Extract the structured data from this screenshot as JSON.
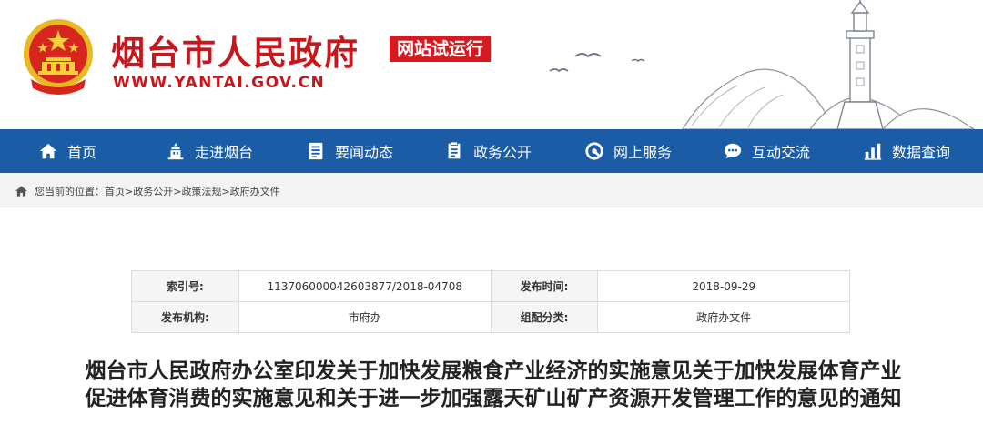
{
  "header": {
    "site_title": "烟台市人民政府",
    "badge": "网站试运行",
    "url": "WWW.YANTAI.GOV.CN",
    "colors": {
      "brand_red": "#c8161d",
      "nav_blue": "#1a5ca6"
    }
  },
  "nav": {
    "items": [
      {
        "label": "首页",
        "icon": "home-icon"
      },
      {
        "label": "走进烟台",
        "icon": "building-icon"
      },
      {
        "label": "要闻动态",
        "icon": "document-icon"
      },
      {
        "label": "政务公开",
        "icon": "file-list-icon"
      },
      {
        "label": "网上服务",
        "icon": "service-icon"
      },
      {
        "label": "互动交流",
        "icon": "chat-icon"
      },
      {
        "label": "数据查询",
        "icon": "chart-icon"
      }
    ]
  },
  "breadcrumb": {
    "prefix": "您当前的位置：",
    "items": [
      "首页",
      "政务公开",
      "政策法规",
      "政府办文件"
    ],
    "separator": ">"
  },
  "info": {
    "index_label": "索引号:",
    "index_value": "113706000042603877/2018-04708",
    "date_label": "发布时间:",
    "date_value": "2018-09-29",
    "org_label": "发布机构:",
    "org_value": "市府办",
    "category_label": "组配分类:",
    "category_value": "政府办文件"
  },
  "document": {
    "title": "烟台市人民政府办公室印发关于加快发展粮食产业经济的实施意见关于加快发展体育产业促进体育消费的实施意见和关于进一步加强露天矿山矿产资源开发管理工作的意见的通知"
  }
}
